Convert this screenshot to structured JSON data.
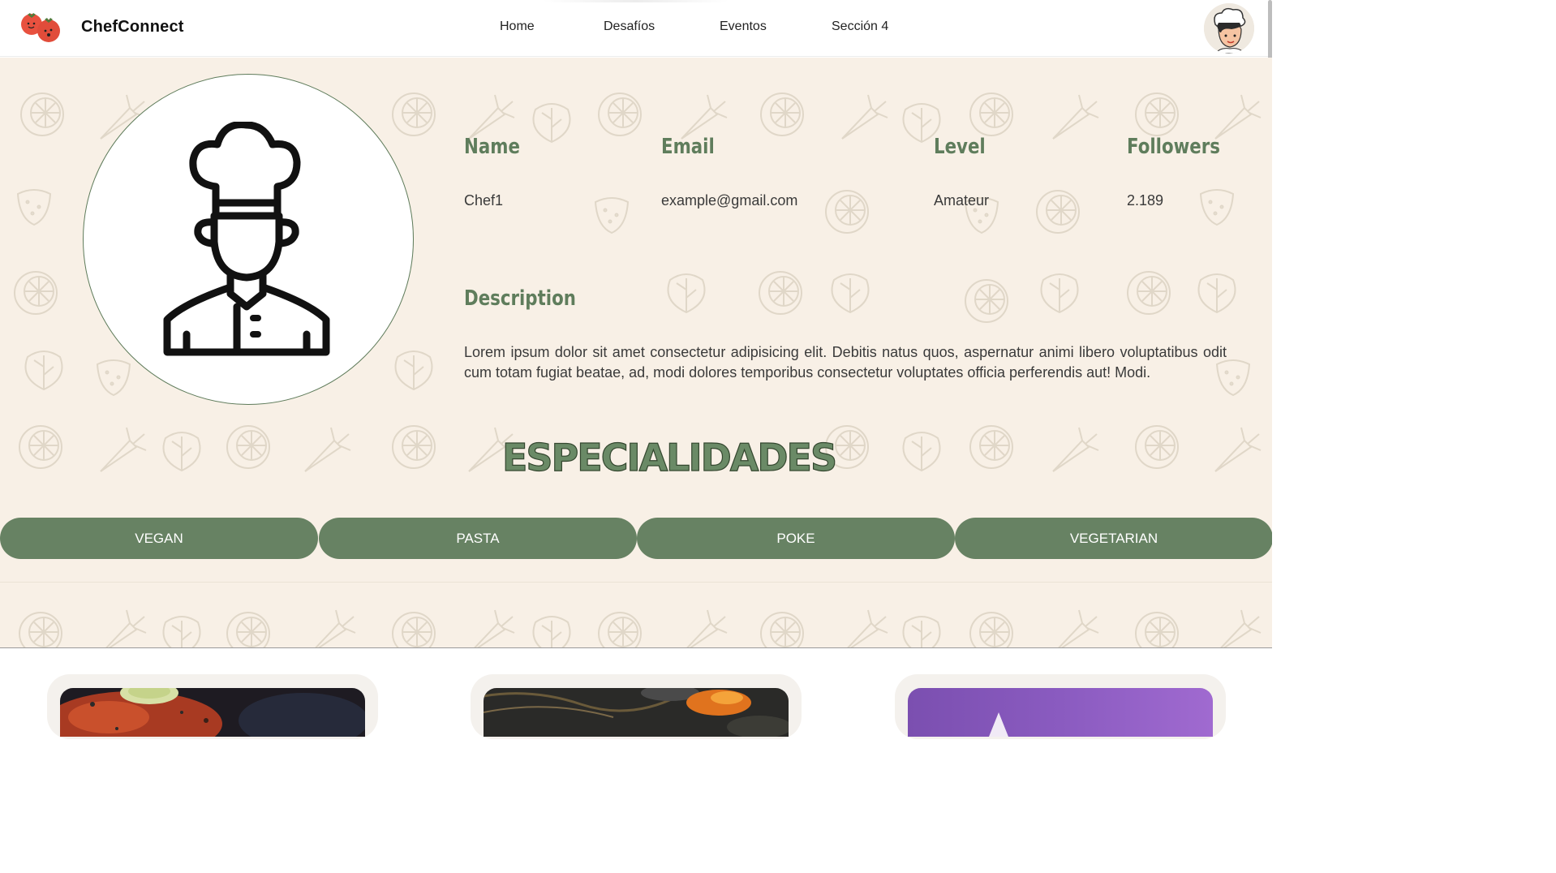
{
  "brand": {
    "name": "ChefConnect",
    "logo_icon": "tomatoes-icon"
  },
  "nav": {
    "links": [
      "Home",
      "Desafíos",
      "Eventos",
      "Sección 4"
    ],
    "avatar_icon": "chef-avatar-icon"
  },
  "profile": {
    "photo_icon": "chef-icon",
    "labels": {
      "name": "Name",
      "email": "Email",
      "level": "Level",
      "followers": "Followers"
    },
    "values": {
      "name": "Chef1",
      "email": "example@gmail.com",
      "level": "Amateur",
      "followers": "2.189"
    },
    "description_title": "Description",
    "description": "Lorem ipsum dolor sit amet consectetur adipisicing elit. Debitis natus quos, aspernatur animi libero voluptatibus odit cum totam fugiat beatae, ad, modi dolores temporibus consectetur voluptates officia perferendis aut! Modi."
  },
  "specialties": {
    "title": "ESPECIALIDADES",
    "items": [
      "VEGAN",
      "PASTA",
      "POKE",
      "VEGETARIAN"
    ]
  },
  "cards": [
    {
      "image": "salmon-dish-photo"
    },
    {
      "image": "orange-dish-photo"
    },
    {
      "image": "purple-dish-photo"
    }
  ],
  "colors": {
    "accent_green": "#678263",
    "heading_green": "#5f7d5c",
    "section_bg": "#f8f0e6"
  }
}
